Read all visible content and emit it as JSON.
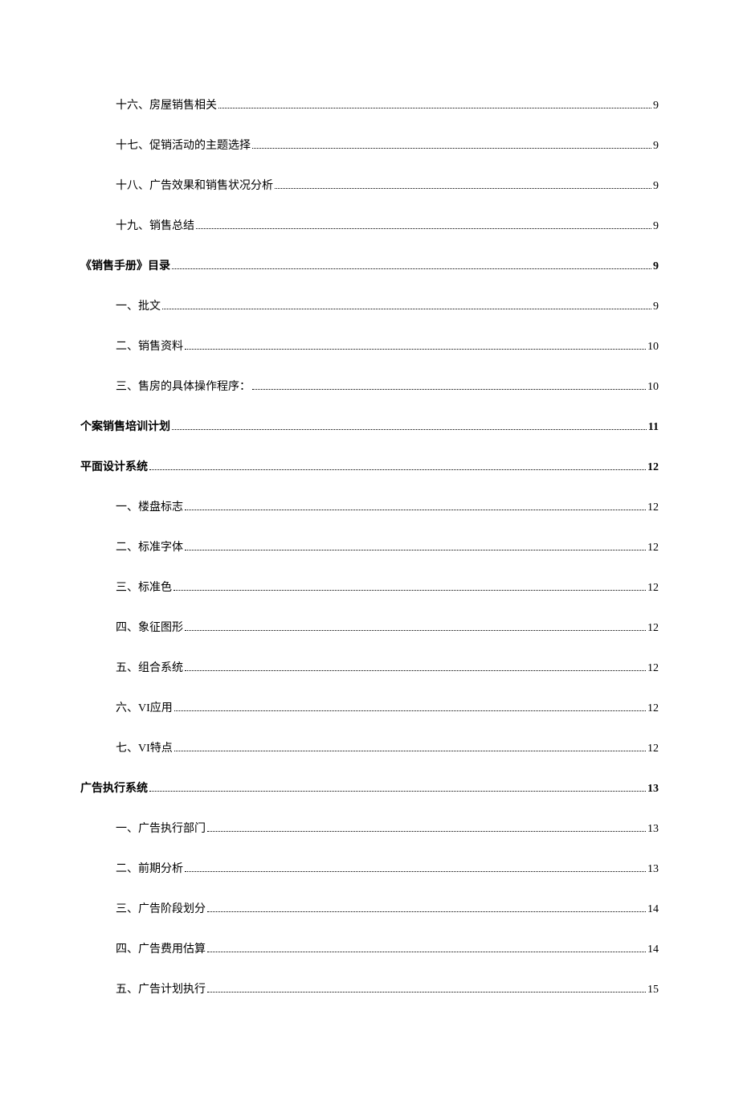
{
  "toc": [
    {
      "level": 2,
      "title": "十六、房屋销售相关",
      "page": "9"
    },
    {
      "level": 2,
      "title": "十七、促销活动的主题选择",
      "page": "9"
    },
    {
      "level": 2,
      "title": "十八、广告效果和销售状况分析",
      "page": "9"
    },
    {
      "level": 2,
      "title": "十九、销售总结",
      "page": "9"
    },
    {
      "level": 1,
      "title": "《销售手册》目录",
      "page": "9"
    },
    {
      "level": 2,
      "title": "一、批文",
      "page": "9"
    },
    {
      "level": 2,
      "title": "二、销售资料",
      "page": "10"
    },
    {
      "level": 2,
      "title": "三、售房的具体操作程序：",
      "page": "10"
    },
    {
      "level": 1,
      "title": "个案销售培训计划",
      "page": "11"
    },
    {
      "level": 1,
      "title": "平面设计系统",
      "page": "12"
    },
    {
      "level": 2,
      "title": "一、楼盘标志",
      "page": "12"
    },
    {
      "level": 2,
      "title": "二、标准字体",
      "page": "12"
    },
    {
      "level": 2,
      "title": "三、标准色",
      "page": "12"
    },
    {
      "level": 2,
      "title": "四、象征图形",
      "page": "12"
    },
    {
      "level": 2,
      "title": "五、组合系统",
      "page": "12"
    },
    {
      "level": 2,
      "title": "六、VI应用",
      "page": "12"
    },
    {
      "level": 2,
      "title": "七、VI特点",
      "page": "12"
    },
    {
      "level": 1,
      "title": "广告执行系统",
      "page": "13"
    },
    {
      "level": 2,
      "title": "一、广告执行部门",
      "page": "13"
    },
    {
      "level": 2,
      "title": "二、前期分析",
      "page": "13"
    },
    {
      "level": 2,
      "title": "三、广告阶段划分",
      "page": "14"
    },
    {
      "level": 2,
      "title": "四、广告费用估算",
      "page": "14"
    },
    {
      "level": 2,
      "title": "五、广告计划执行",
      "page": "15"
    }
  ]
}
